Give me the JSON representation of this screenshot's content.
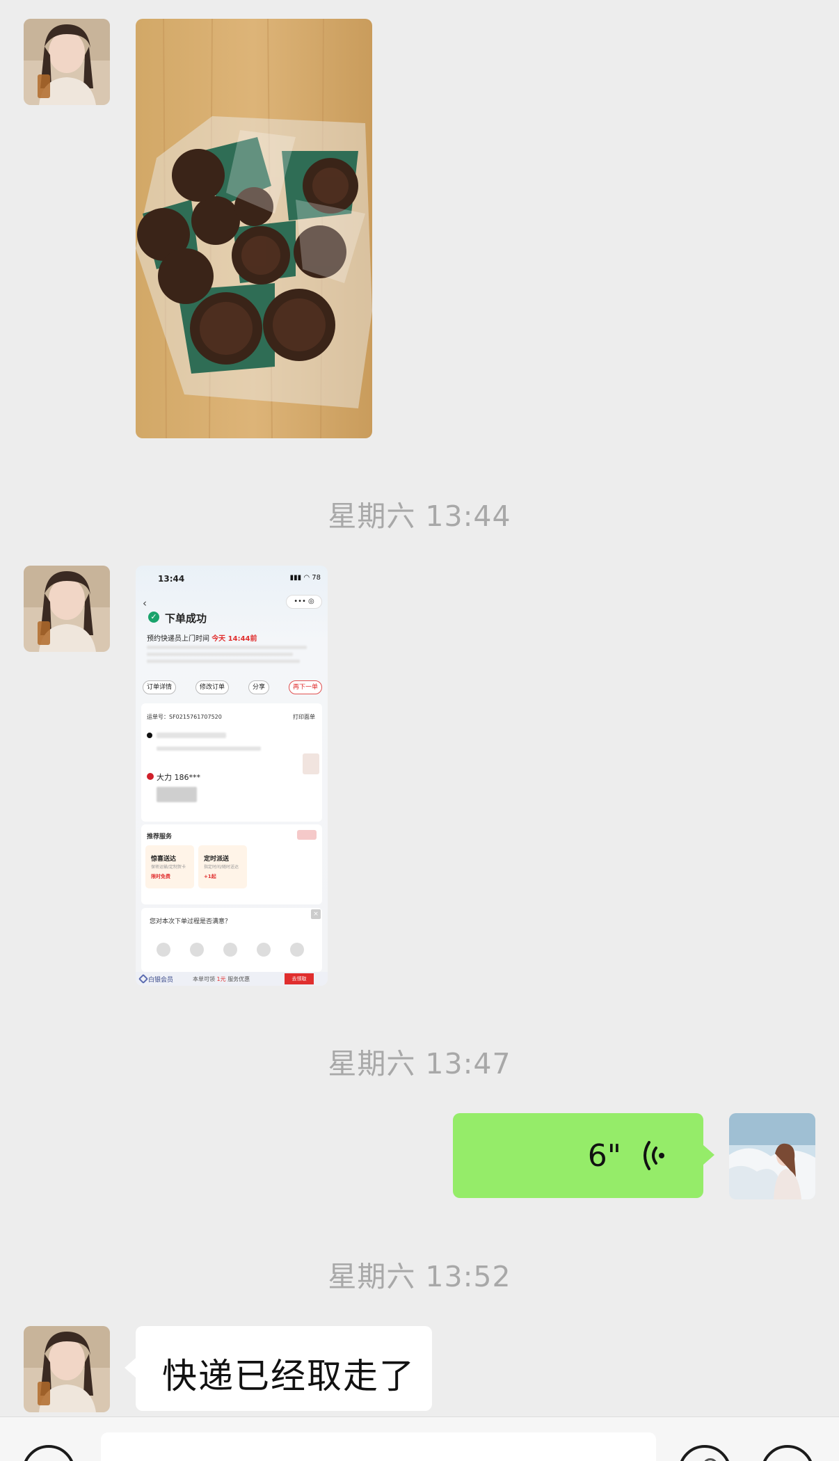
{
  "chat": {
    "timestamps": [
      "星期六 13:44",
      "星期六 13:47",
      "星期六 13:52"
    ],
    "messages": {
      "voice_duration": "6\"",
      "text_message": "快递已经取走了"
    },
    "order_screenshot": {
      "status_time": "13:44",
      "battery": "78",
      "title": "下单成功",
      "subtitle_prefix": "预约快递员上门时间",
      "subtitle_time": "今天 14:44前",
      "buttons": [
        "订单详情",
        "修改订单",
        "分享",
        "再下一单"
      ],
      "waybill_label": "运单号：SF0215761707520",
      "print_label": "打印面单",
      "receiver": "大力 186***",
      "recommend_title": "推荐服务",
      "services": [
        {
          "name": "惊喜送达",
          "desc": "保密运输/定制贺卡",
          "price": "限时免费"
        },
        {
          "name": "定时派送",
          "desc": "指定时间/随时送达",
          "price": "+1起"
        }
      ],
      "survey_question": "您对本次下单过程是否满意？",
      "member_label": "白银会员",
      "member_text_prefix": "本单可领",
      "member_amount": "1元",
      "member_text_suffix": "服务优惠",
      "member_button": "去领取"
    }
  },
  "colors": {
    "background": "#ededed",
    "self_bubble": "#95ec69",
    "other_bubble": "#ffffff",
    "timestamp": "#a8a8a8",
    "accent_red": "#e02e2e",
    "success_green": "#19a36b"
  }
}
